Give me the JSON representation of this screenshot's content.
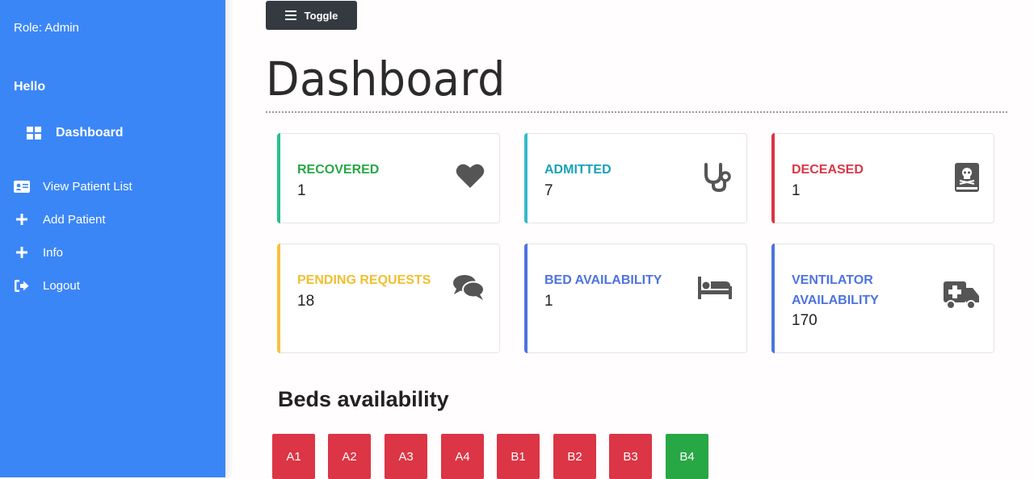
{
  "sidebar": {
    "role": "Role: Admin",
    "greeting": "Hello",
    "items": [
      {
        "label": "Dashboard",
        "icon": "dashboard-grid-icon"
      },
      {
        "label": "View Patient List",
        "icon": "id-card-icon"
      },
      {
        "label": "Add Patient",
        "icon": "plus-icon"
      },
      {
        "label": "Info",
        "icon": "plus-icon"
      },
      {
        "label": "Logout",
        "icon": "logout-icon"
      }
    ]
  },
  "toolbar": {
    "toggle_label": "Toggle"
  },
  "page": {
    "title": "Dashboard"
  },
  "cards": [
    {
      "label": "RECOVERED",
      "value": "1",
      "color": "#28a745",
      "icon": "heart-icon"
    },
    {
      "label": "ADMITTED",
      "value": "7",
      "color": "#17a2b8",
      "icon": "stethoscope-icon"
    },
    {
      "label": "DECEASED",
      "value": "1",
      "color": "#dc3545",
      "icon": "skull-book-icon"
    },
    {
      "label": "PENDING REQUESTS",
      "value": "18",
      "color": "#f0c030",
      "icon": "chat-icon"
    },
    {
      "label": "BED AVAILABILITY",
      "value": "1",
      "color": "#4e73df",
      "icon": "bed-icon"
    },
    {
      "label": "VENTILATOR AVAILABILITY",
      "value": "170",
      "color": "#4e73df",
      "icon": "ambulance-icon"
    }
  ],
  "beds": {
    "title": "Beds availability",
    "list": [
      {
        "name": "A1",
        "color": "#dc3545"
      },
      {
        "name": "A2",
        "color": "#dc3545"
      },
      {
        "name": "A3",
        "color": "#dc3545"
      },
      {
        "name": "A4",
        "color": "#dc3545"
      },
      {
        "name": "B1",
        "color": "#dc3545"
      },
      {
        "name": "B2",
        "color": "#dc3545"
      },
      {
        "name": "B3",
        "color": "#dc3545"
      },
      {
        "name": "B4",
        "color": "#28a745"
      }
    ]
  }
}
